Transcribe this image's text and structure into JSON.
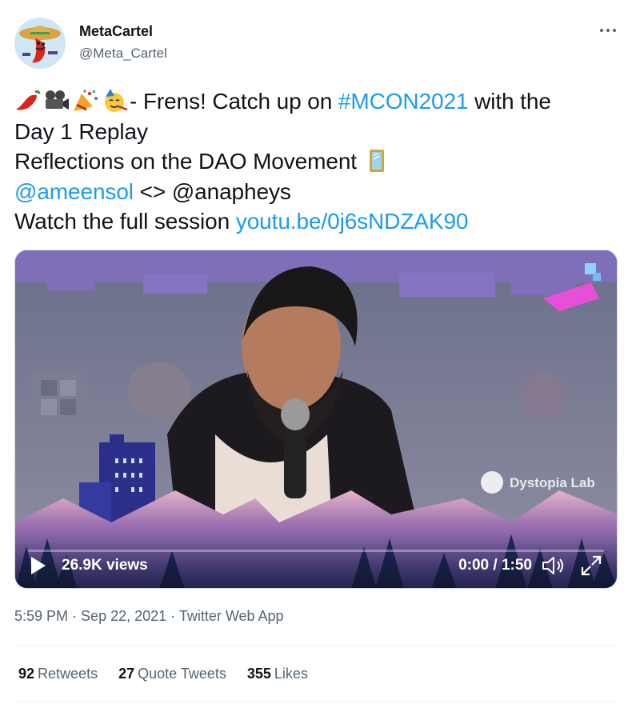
{
  "author": {
    "name": "MetaCartel",
    "handle": "@Meta_Cartel"
  },
  "tweet": {
    "line1_post": "- Frens! Catch up on ",
    "hashtag": "#MCON2021",
    "line1_end": " with the",
    "line2": "Day 1 Replay",
    "line3": "Reflections on the DAO Movement ",
    "mention1": "@ameensol",
    "mention_sep": " <> ",
    "mention2_plain": "@anapheys",
    "line5_pre": "Watch the full session ",
    "video_link": "youtu.be/0j6sNDZAK90",
    "emojis": [
      "chili-pepper",
      "movie-camera",
      "party-popper",
      "partying-face",
      "mirror"
    ]
  },
  "video": {
    "views": "26.9K views",
    "time": "0:00 / 1:50",
    "backdrop_text": "Dystopia Lab"
  },
  "meta": {
    "time": "5:59 PM",
    "sep": " · ",
    "date": "Sep 22, 2021",
    "source": "Twitter Web App"
  },
  "stats": {
    "retweets_count": "92",
    "retweets_label": "Retweets",
    "quotes_count": "27",
    "quotes_label": "Quote Tweets",
    "likes_count": "355",
    "likes_label": "Likes"
  },
  "colors": {
    "link": "#1d9bf0",
    "secondary_text": "#536471",
    "primary_text": "#0f1419"
  }
}
